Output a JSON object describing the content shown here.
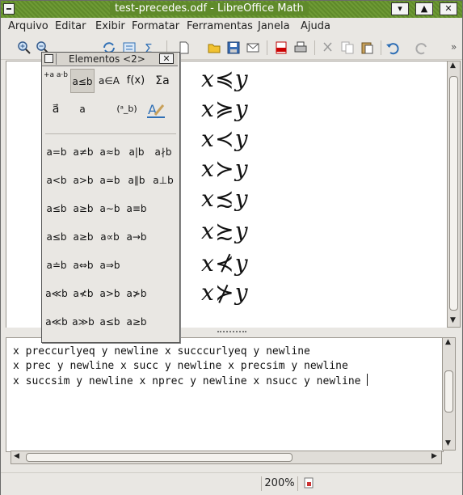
{
  "window": {
    "title": "test-precedes.odf - LibreOffice Math"
  },
  "titlebar": {
    "min_label": "▾",
    "max_label": "▲",
    "close_label": "✕"
  },
  "menu": {
    "items": [
      "Arquivo",
      "Editar",
      "Exibir",
      "Formatar",
      "Ferramentas",
      "Janela",
      "Ajuda"
    ]
  },
  "toolbar": {
    "icons": [
      "zoom-in-icon",
      "zoom-out-icon",
      "refresh-icon",
      "formula-cursor-icon",
      "symbols-icon",
      "new-icon",
      "open-icon",
      "save-icon",
      "email-icon",
      "export-pdf-icon",
      "print-icon",
      "cut-icon",
      "copy-icon",
      "paste-icon",
      "undo-icon",
      "redo-icon"
    ]
  },
  "preview": {
    "formulas": [
      {
        "left": "x",
        "op": "≼",
        "right": "y"
      },
      {
        "left": "x",
        "op": "≽",
        "right": "y"
      },
      {
        "left": "x",
        "op": "≺",
        "right": "y"
      },
      {
        "left": "x",
        "op": "≻",
        "right": "y"
      },
      {
        "left": "x",
        "op": "≾",
        "right": "y"
      },
      {
        "left": "x",
        "op": "≿",
        "right": "y"
      },
      {
        "left": "x",
        "op": "⊀",
        "right": "y"
      },
      {
        "left": "x",
        "op": "⊁",
        "right": "y"
      }
    ]
  },
  "command": {
    "lines": [
      "x preccurlyeq y newline x succcurlyeq y newline",
      "x prec y newline x succ y newline x precsim y newline",
      "x succsim y newline x nprec y newline x nsucc y newline "
    ]
  },
  "status": {
    "zoom": "200%"
  },
  "elements": {
    "title": "Elementos <2>",
    "close_label": "✕",
    "categories": [
      "+a a·b",
      "a≤b",
      "a∈A",
      "f(x)",
      "Σa",
      "a⃗",
      "a",
      "(ᵃ_b)",
      "edit"
    ],
    "symbols": [
      [
        "a=b",
        "a≠b",
        "a≈b",
        "a|b",
        "a∤b"
      ],
      [
        "a<b",
        "a>b",
        "a≃b",
        "a∥b",
        "a⊥b"
      ],
      [
        "a≤b",
        "a≥b",
        "a∼b",
        "a≡b",
        ""
      ],
      [
        "a≤b",
        "a≥b",
        "a∝b",
        "a→b",
        ""
      ],
      [
        "a≐b",
        "a⇔b",
        "a⇒b",
        "",
        ""
      ],
      [
        "a≪b",
        "a≮b",
        "a>b",
        "a≯b",
        ""
      ],
      [
        "a≪b",
        "a≫b",
        "a≤b",
        "a≥b",
        ""
      ]
    ]
  }
}
